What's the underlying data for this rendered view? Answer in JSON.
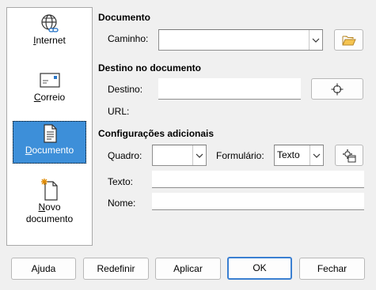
{
  "sidebar": {
    "items": [
      {
        "label": "Internet",
        "icon": "globe-link-icon"
      },
      {
        "label": "Correio",
        "icon": "envelope-icon"
      },
      {
        "label": "Documento",
        "icon": "document-icon",
        "selected": true
      },
      {
        "label": "Novo documento",
        "line1": "Novo",
        "line2": "documento",
        "icon": "new-document-icon"
      }
    ]
  },
  "document": {
    "heading": "Documento",
    "path_label": "Caminho:",
    "path_value": ""
  },
  "target": {
    "heading": "Destino no documento",
    "target_label": "Destino:",
    "target_value": "",
    "url_label": "URL:"
  },
  "additional": {
    "heading": "Configurações adicionais",
    "frame_label": "Quadro:",
    "frame_value": "",
    "form_label": "Formulário:",
    "form_value": "Texto",
    "text_label": "Texto:",
    "text_value": "",
    "name_label": "Nome:",
    "name_value": ""
  },
  "buttons": {
    "help": "Ajuda",
    "reset": "Redefinir",
    "apply": "Aplicar",
    "ok": "OK",
    "close": "Fechar"
  }
}
